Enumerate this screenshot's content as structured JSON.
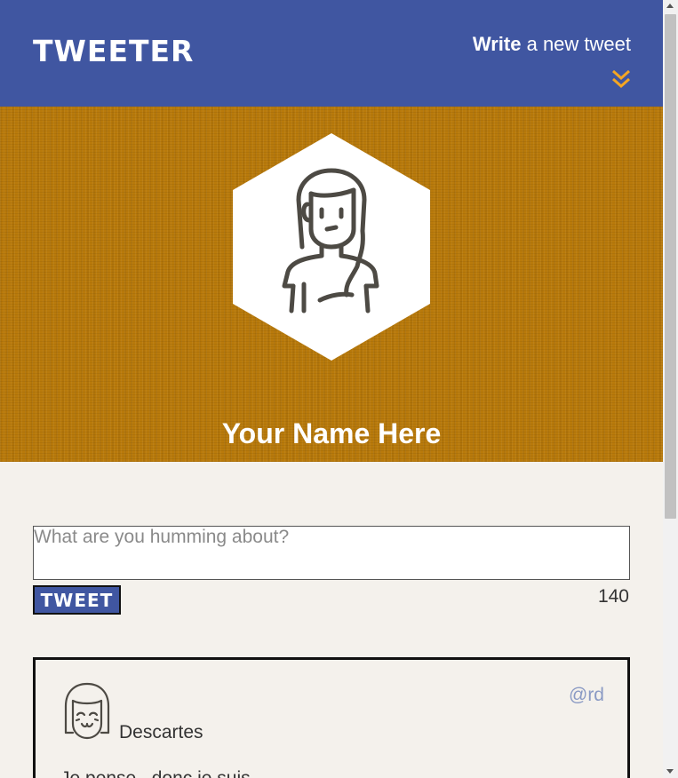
{
  "nav": {
    "logo": "TWEETER",
    "compose_bold": "Write",
    "compose_rest": " a new tweet",
    "toggle_icon": "double-chevron-down-icon",
    "accent_color": "#f5a623"
  },
  "header": {
    "profile_name": "Your Name Here",
    "avatar_icon": "person-avatar-icon",
    "background_color": "#b97a0b"
  },
  "compose": {
    "placeholder": "What are you humming about?",
    "button_label": "TWEET",
    "counter": "140"
  },
  "tweets": [
    {
      "author": "Descartes",
      "handle": "@rd",
      "content": "Je pense , donc je suis",
      "avatar_icon": "smiling-girl-avatar-icon"
    }
  ],
  "colors": {
    "nav": "#4056a1",
    "page_background": "#f4f1ec",
    "handle": "#8a9ac4"
  }
}
